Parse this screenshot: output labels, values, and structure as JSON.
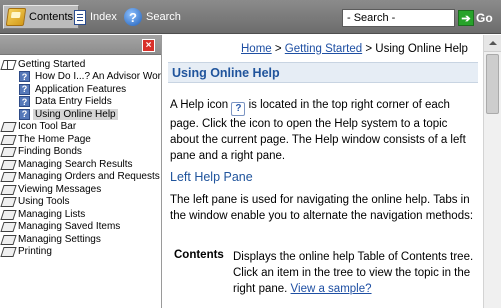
{
  "toolbar": {
    "contents_label": "Contents",
    "index_label": "Index",
    "search_label": "Search",
    "search_placeholder": "- Search -",
    "go_label": "Go"
  },
  "left_pane": {
    "tree": [
      {
        "label": "Getting Started",
        "type": "book-open"
      },
      {
        "label": "How Do I...? An Advisor Wor",
        "type": "topic"
      },
      {
        "label": "Application Features",
        "type": "topic"
      },
      {
        "label": "Data Entry Fields",
        "type": "topic"
      },
      {
        "label": "Using Online Help",
        "type": "topic"
      },
      {
        "label": "Icon Tool Bar",
        "type": "book"
      },
      {
        "label": "The Home Page",
        "type": "book"
      },
      {
        "label": "Finding Bonds",
        "type": "book"
      },
      {
        "label": "Managing Search Results",
        "type": "book"
      },
      {
        "label": "Managing Orders and Requests",
        "type": "book"
      },
      {
        "label": "Viewing Messages",
        "type": "book"
      },
      {
        "label": "Using Tools",
        "type": "book"
      },
      {
        "label": "Managing Lists",
        "type": "book"
      },
      {
        "label": "Managing Saved Items",
        "type": "book"
      },
      {
        "label": "Managing Settings",
        "type": "book"
      },
      {
        "label": "Printing",
        "type": "book"
      }
    ]
  },
  "right_pane": {
    "breadcrumb": {
      "home": "Home",
      "sep1": " > ",
      "getting_started": "Getting Started",
      "sep2": " > ",
      "current": "Using Online Help"
    },
    "title": "Using Online Help",
    "para1_a": "A Help icon ",
    "para1_b": " is located in the top right corner of each page. Click the icon to open the Help system to a topic about the current page. The Help window consists of a left pane and a right pane.",
    "heading_left_pane": "Left Help Pane",
    "para2": "The left pane is used for navigating the online help. Tabs in the window enable you to alternate the navigation methods:",
    "def_term": "Contents",
    "def_body": "Displays the online help Table of Contents tree. Click an item in the tree to view the topic in the right pane. ",
    "def_link": "View a sample?"
  },
  "colors": {
    "toolbar": "#7a7a7a",
    "link": "#1e4fa3",
    "title": "#20549c",
    "close": "#d9302a",
    "go": "#27a32a"
  }
}
